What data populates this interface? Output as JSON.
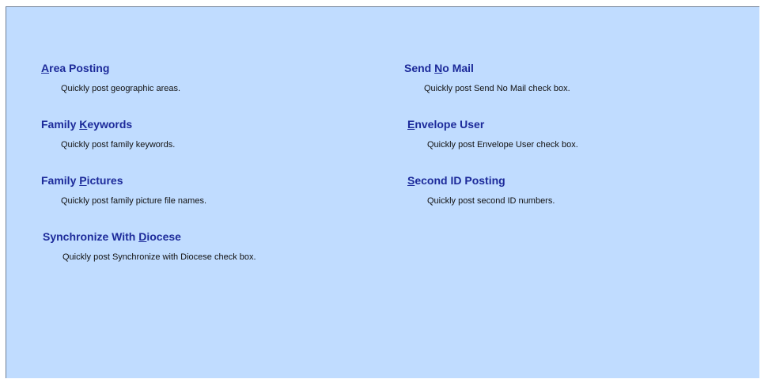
{
  "options": [
    {
      "prefix": "",
      "accel": "A",
      "suffix": "rea Posting",
      "description": "Quickly post geographic areas."
    },
    {
      "prefix": "Family ",
      "accel": "K",
      "suffix": "eywords",
      "description": "Quickly post family keywords."
    },
    {
      "prefix": "Family ",
      "accel": "P",
      "suffix": "ictures",
      "description": "Quickly post family picture file names."
    },
    {
      "prefix": "Synchronize With ",
      "accel": "D",
      "suffix": "iocese",
      "description": "Quickly post Synchronize with Diocese check box."
    },
    {
      "prefix": "Send ",
      "accel": "N",
      "suffix": "o Mail",
      "description": "Quickly post Send No Mail check box."
    },
    {
      "prefix": "",
      "accel": "E",
      "suffix": "nvelope User",
      "description": "Quickly post Envelope User check box."
    },
    {
      "prefix": "",
      "accel": "S",
      "suffix": "econd ID Posting",
      "description": "Quickly post second ID numbers."
    }
  ]
}
